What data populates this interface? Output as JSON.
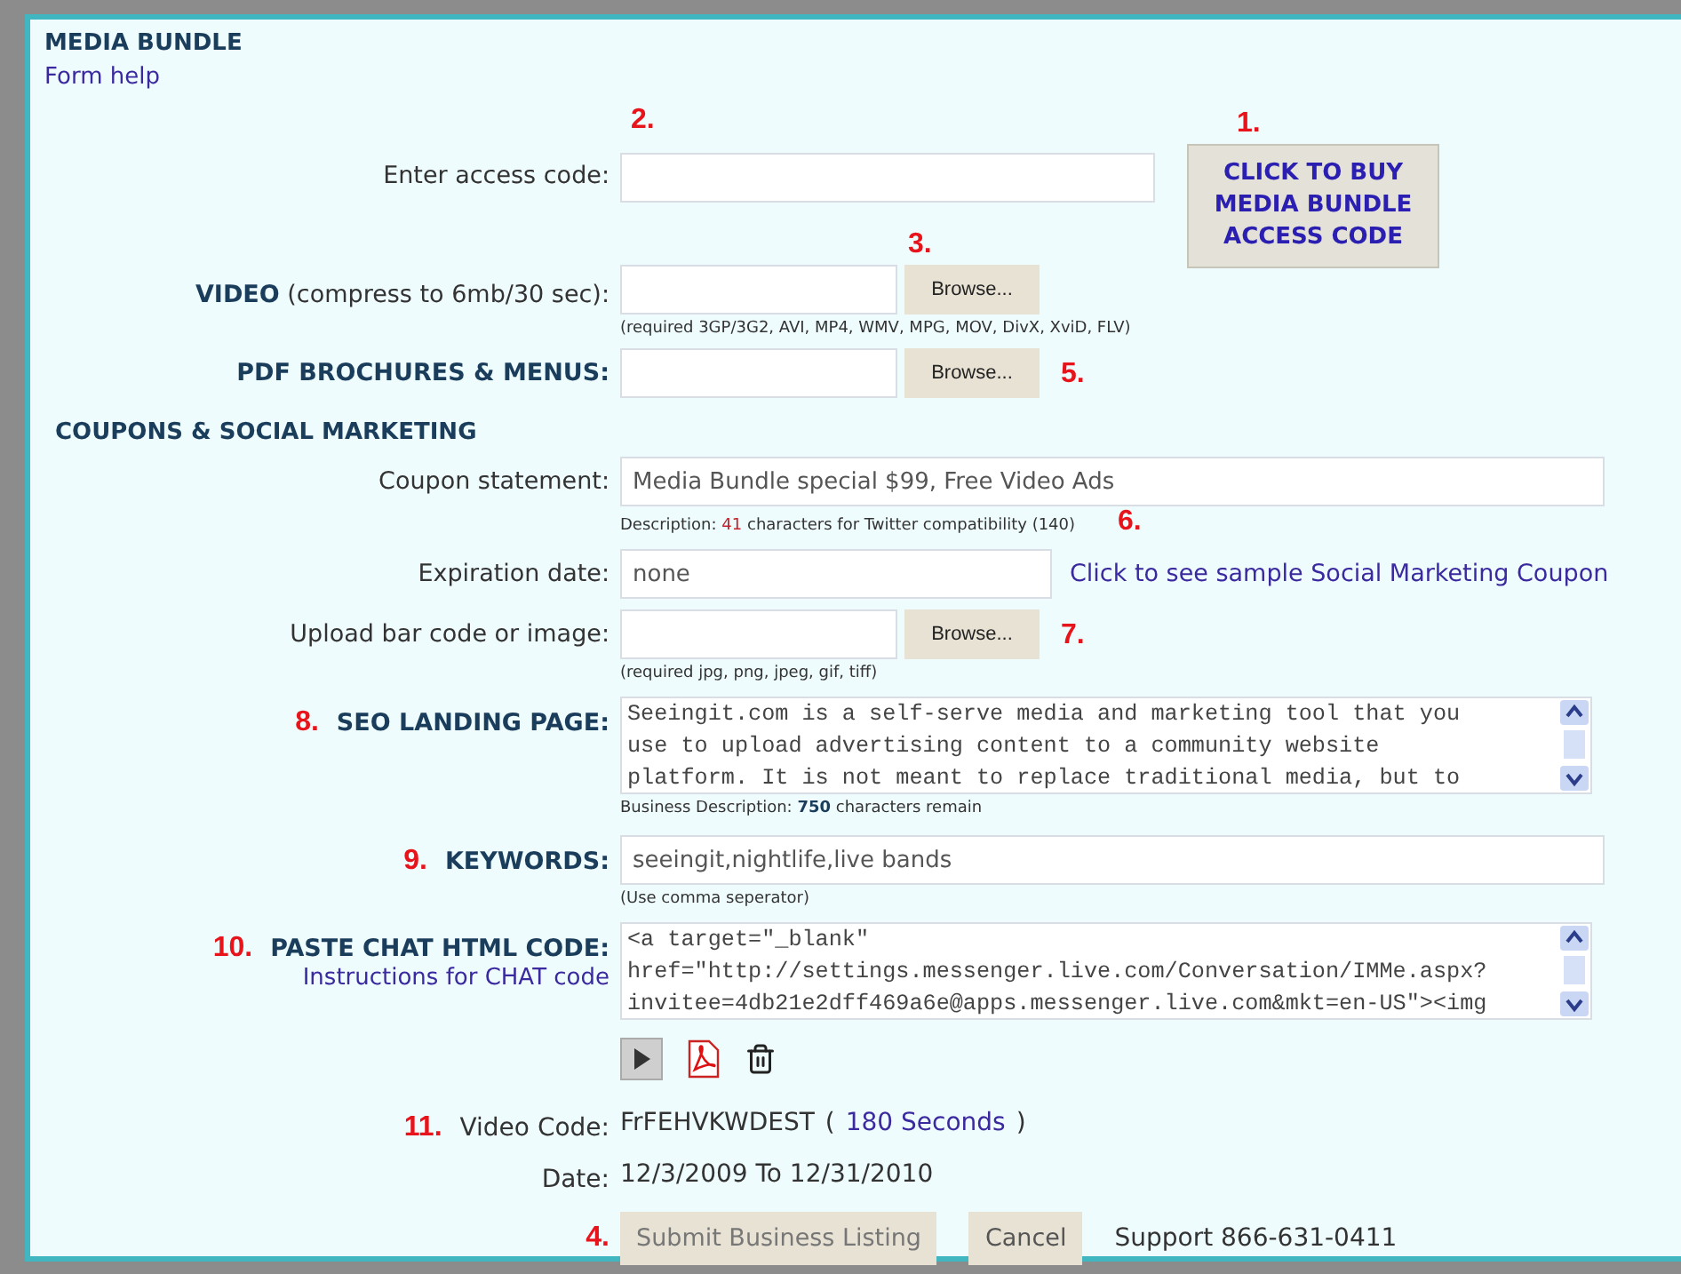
{
  "header": {
    "title": "MEDIA BUNDLE",
    "help_link": "Form help"
  },
  "rows": [
    {
      "kind": "access",
      "label": "Enter access code:",
      "step": "2.",
      "value": "",
      "buy_step": "1.",
      "buy_button": "CLICK TO BUY MEDIA BUNDLE ACCESS CODE"
    },
    {
      "kind": "file",
      "label": "**VIDEO** (compress to 6mb/30 sec):",
      "browse": "Browse...",
      "step_above": "3.",
      "hint": "(required 3GP/3G2, AVI, MP4, WMV, MPG, MOV, DivX, XviD, FLV)"
    },
    {
      "kind": "file",
      "label": "**PDF BROCHURES & MENUS:**",
      "browse": "Browse...",
      "step": "5."
    },
    {
      "kind": "section",
      "label": "COUPONS & SOCIAL MARKETING"
    },
    {
      "kind": "input",
      "label": "Coupon statement:",
      "value": "Media Bundle special $99, Free Video Ads",
      "note": {
        "prefix": "Description:",
        "count": "41",
        "suffix": "characters for Twitter compatibility (140)"
      },
      "note_step": "6."
    },
    {
      "kind": "input",
      "label": "Expiration date:",
      "value": "none",
      "link": "Click to see sample Social Marketing Coupon"
    },
    {
      "kind": "file",
      "label": "Upload bar code or image:",
      "browse": "Browse...",
      "step": "7.",
      "hint": "(required jpg, png, jpeg, gif, tiff)"
    },
    {
      "kind": "textarea",
      "step": "8.",
      "label": "SEO LANDING PAGE:",
      "value": "Seeingit.com is a self-serve media and marketing tool that you\nuse to upload advertising content to a community website\nplatform. It is not meant to replace traditional media, but to",
      "note": {
        "prefix": "Business Description:",
        "count": "750",
        "suffix": "characters remain"
      }
    },
    {
      "kind": "input",
      "step": "9.",
      "label": "KEYWORDS:",
      "value": "seeingit,nightlife,live bands",
      "hint": "(Use comma seperator)"
    },
    {
      "kind": "textarea",
      "step": "10.",
      "label": "PASTE CHAT HTML CODE:",
      "sublink": "Instructions for CHAT code",
      "value": "<a target=\"_blank\"\nhref=\"http://settings.messenger.live.com/Conversation/IMMe.aspx?\ninvitee=4db21e2dff469a6e@apps.messenger.live.com&mkt=en-US\"><img"
    },
    {
      "kind": "icons"
    },
    {
      "kind": "info",
      "step": "11.",
      "label": "Video Code:",
      "value": "FrFEHVKWDEST",
      "open": "(",
      "link": "180 Seconds",
      "close": ")"
    },
    {
      "kind": "info",
      "label": "Date:",
      "value": "12/3/2009 To 12/31/2010"
    },
    {
      "kind": "actions",
      "step": "4.",
      "buttons": [
        {
          "label": "Submit Business Listing",
          "disabled": true
        },
        {
          "label": "Cancel",
          "disabled": false
        }
      ],
      "support": "Support 866-631-0411"
    }
  ]
}
